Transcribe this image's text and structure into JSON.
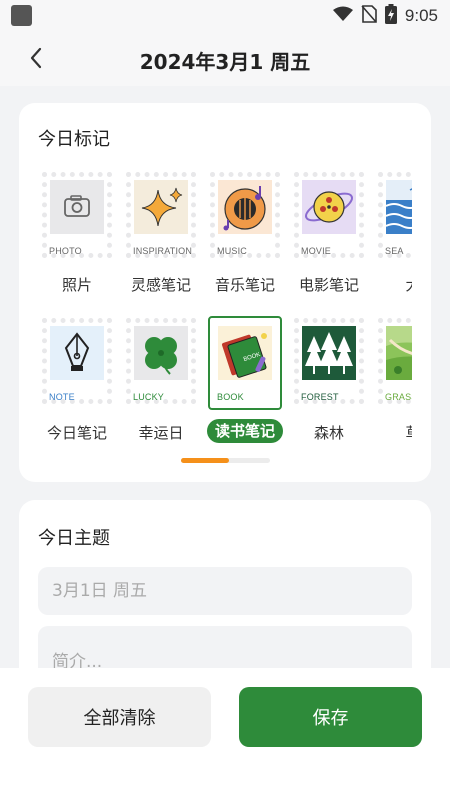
{
  "status_bar": {
    "time": "9:05",
    "icons": [
      "wifi-icon",
      "no-sim-icon",
      "battery-charging-icon"
    ]
  },
  "header": {
    "back_icon": "chevron-left-icon",
    "title": "2024年3月1 周五"
  },
  "marks_section": {
    "title": "今日标记",
    "row1": [
      {
        "tag": "PHOTO",
        "label": "照片"
      },
      {
        "tag": "INSPIRATION",
        "label": "灵感笔记"
      },
      {
        "tag": "MUSIC",
        "label": "音乐笔记"
      },
      {
        "tag": "MOVIE",
        "label": "电影笔记"
      },
      {
        "tag": "SEA",
        "label": "大"
      }
    ],
    "row2": [
      {
        "tag": "NOTE",
        "label": "今日笔记"
      },
      {
        "tag": "LUCKY",
        "label": "幸运日"
      },
      {
        "tag": "BOOK",
        "label": "读书笔记",
        "selected": true
      },
      {
        "tag": "FOREST",
        "label": "森林"
      },
      {
        "tag": "GRASS",
        "label": "草"
      }
    ],
    "scroll_progress": 0.54,
    "accent_color": "#2e8b3a",
    "indicator_color": "#f5901a"
  },
  "theme_section": {
    "title": "今日主题",
    "topic_placeholder": "3月1日 周五",
    "intro_placeholder": "简介..."
  },
  "actions": {
    "clear_label": "全部清除",
    "save_label": "保存"
  }
}
